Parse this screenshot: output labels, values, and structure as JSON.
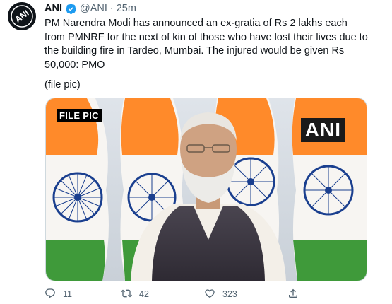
{
  "tweet": {
    "author_name": "ANI",
    "handle": "@ANI",
    "separator": "·",
    "time": "25m",
    "text": "PM Narendra Modi has announced an ex-gratia of Rs 2 lakhs each from PMNRF for the next of kin of those who have lost their lives due to the building fire in Tardeo, Mumbai. The injured would be given Rs 50,000: PMO",
    "note": "(file pic)",
    "avatar_text": "ANI",
    "media": {
      "label": "FILE PIC",
      "watermark": "ANI"
    },
    "stats": {
      "replies": "11",
      "retweets": "42",
      "likes": "323"
    }
  },
  "icons": {
    "verified": "verified-badge-icon",
    "reply": "reply-icon",
    "retweet": "retweet-icon",
    "like": "heart-icon",
    "share": "share-icon"
  },
  "colors": {
    "verified": "#1d9bf0",
    "text": "#0f1419",
    "muted": "#536471",
    "saffron": "#ff8a2a",
    "green": "#3f9a3a",
    "chakra": "#1a3f8f"
  }
}
